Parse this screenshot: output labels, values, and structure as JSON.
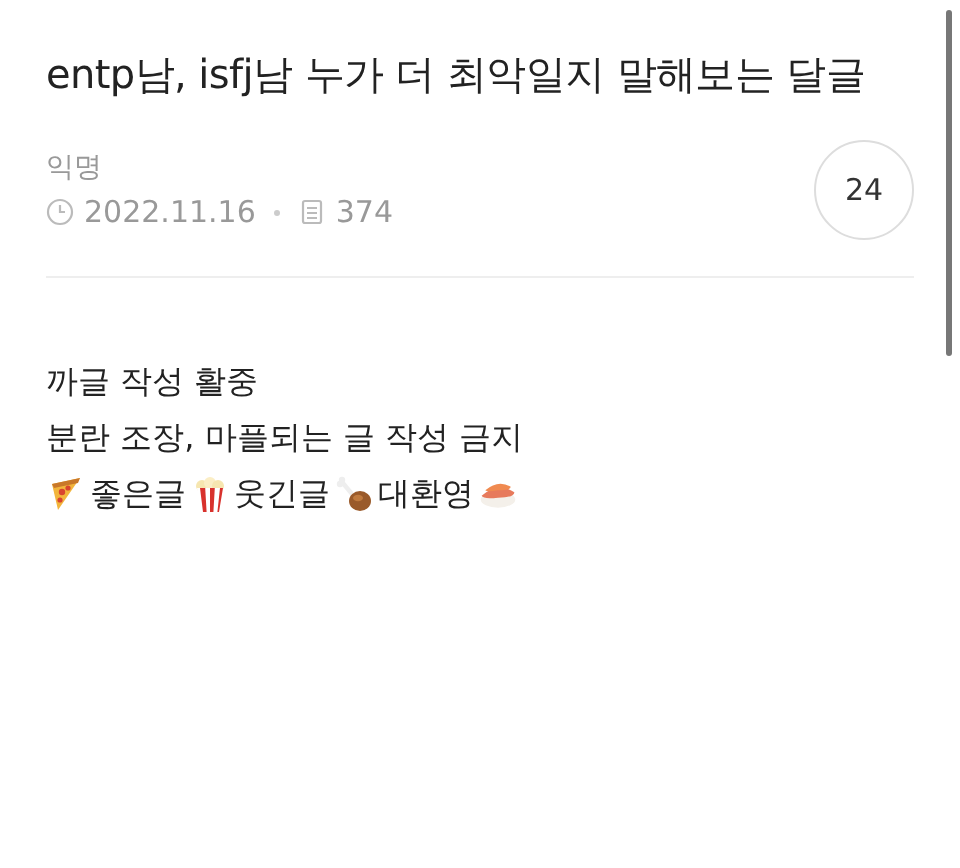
{
  "post": {
    "title": "entp남, isfj남 누가 더 최악일지 말해보는 달글",
    "author": "익명",
    "date": "2022.11.16",
    "views": "374",
    "comment_count": "24"
  },
  "body": {
    "lines": [
      "까글 작성 활중",
      "분란 조장, 마플되는 글 작성 금지"
    ],
    "tags": [
      "좋은글",
      "웃긴글",
      "대환영"
    ]
  }
}
